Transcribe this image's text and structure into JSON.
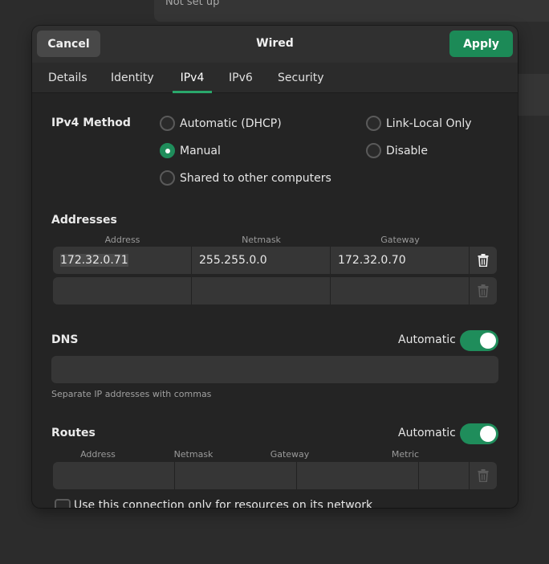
{
  "background": {
    "panel_text": "Not set up"
  },
  "dialog": {
    "title": "Wired",
    "cancel_label": "Cancel",
    "apply_label": "Apply"
  },
  "tabs": [
    {
      "label": "Details",
      "active": false
    },
    {
      "label": "Identity",
      "active": false
    },
    {
      "label": "IPv4",
      "active": true
    },
    {
      "label": "IPv6",
      "active": false
    },
    {
      "label": "Security",
      "active": false
    }
  ],
  "ipv4_method": {
    "label": "IPv4 Method",
    "options": [
      {
        "label": "Automatic (DHCP)",
        "checked": false
      },
      {
        "label": "Link-Local Only",
        "checked": false
      },
      {
        "label": "Manual",
        "checked": true
      },
      {
        "label": "Disable",
        "checked": false
      },
      {
        "label": "Shared to other computers",
        "checked": false
      }
    ]
  },
  "addresses": {
    "label": "Addresses",
    "columns": [
      "Address",
      "Netmask",
      "Gateway"
    ],
    "rows": [
      {
        "address": "172.32.0.71",
        "netmask": "255.255.0.0",
        "gateway": "172.32.0.70"
      },
      {
        "address": "",
        "netmask": "",
        "gateway": ""
      }
    ]
  },
  "dns": {
    "label": "DNS",
    "automatic_label": "Automatic",
    "automatic": true,
    "value": "",
    "hint": "Separate IP addresses with commas"
  },
  "routes": {
    "label": "Routes",
    "automatic_label": "Automatic",
    "automatic": true,
    "columns": [
      "Address",
      "Netmask",
      "Gateway",
      "Metric"
    ],
    "rows": [
      {
        "address": "",
        "netmask": "",
        "gateway": "",
        "metric": ""
      }
    ]
  },
  "only_local": {
    "label": "Use this connection only for resources on its network",
    "checked": false
  },
  "colors": {
    "accent": "#1f8d5b",
    "apply_button": "#1c8a57",
    "dialog_bg": "#242424",
    "entry_bg": "#363636"
  }
}
